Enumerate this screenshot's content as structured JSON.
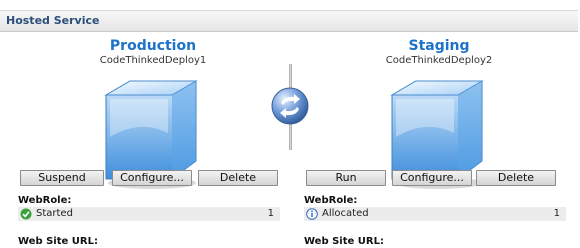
{
  "header": {
    "title": "Hosted Service"
  },
  "production": {
    "title": "Production",
    "deployment_name": "CodeThinkedDeploy1",
    "buttons": {
      "suspend": "Suspend",
      "configure": "Configure...",
      "delete": "Delete"
    },
    "role": {
      "label": "WebRole:",
      "status": "Started",
      "status_icon": "check-circle-icon",
      "count": "1"
    },
    "url_label": "Web Site URL:"
  },
  "staging": {
    "title": "Staging",
    "deployment_name": "CodeThinkedDeploy2",
    "buttons": {
      "run": "Run",
      "configure": "Configure...",
      "delete": "Delete"
    },
    "role": {
      "label": "WebRole:",
      "status": "Allocated",
      "status_icon": "info-circle-icon",
      "count": "1"
    },
    "url_label": "Web Site URL:"
  },
  "swap": {
    "icon": "swap-arrows-icon"
  },
  "colors": {
    "accent": "#1e73c8",
    "header_text": "#2b4f7a",
    "started": "#3aa23a",
    "info": "#3a6fb5"
  }
}
